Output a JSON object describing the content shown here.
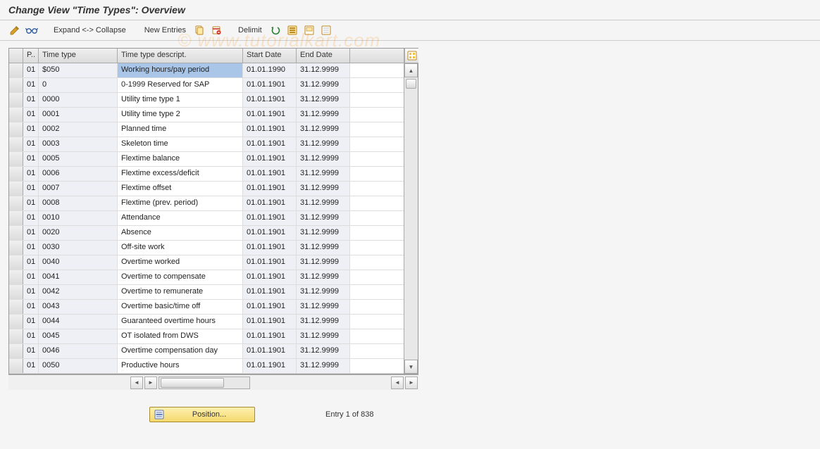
{
  "page": {
    "title": "Change View \"Time Types\": Overview"
  },
  "toolbar": {
    "expand_collapse": "Expand <-> Collapse",
    "new_entries": "New Entries",
    "delimit": "Delimit"
  },
  "table": {
    "columns": {
      "p": "P..",
      "time_type": "Time type",
      "descript": "Time type descript.",
      "start": "Start Date",
      "end": "End Date"
    },
    "rows": [
      {
        "p": "01",
        "tt": "$050",
        "d": "Working hours/pay period",
        "sd": "01.01.1990",
        "ed": "31.12.9999",
        "selected": true
      },
      {
        "p": "01",
        "tt": "0",
        "d": "0-1999 Reserved for SAP",
        "sd": "01.01.1901",
        "ed": "31.12.9999"
      },
      {
        "p": "01",
        "tt": "0000",
        "d": "Utility time type 1",
        "sd": "01.01.1901",
        "ed": "31.12.9999"
      },
      {
        "p": "01",
        "tt": "0001",
        "d": "Utility time type 2",
        "sd": "01.01.1901",
        "ed": "31.12.9999"
      },
      {
        "p": "01",
        "tt": "0002",
        "d": "Planned time",
        "sd": "01.01.1901",
        "ed": "31.12.9999"
      },
      {
        "p": "01",
        "tt": "0003",
        "d": "Skeleton time",
        "sd": "01.01.1901",
        "ed": "31.12.9999"
      },
      {
        "p": "01",
        "tt": "0005",
        "d": "Flextime balance",
        "sd": "01.01.1901",
        "ed": "31.12.9999"
      },
      {
        "p": "01",
        "tt": "0006",
        "d": "Flextime excess/deficit",
        "sd": "01.01.1901",
        "ed": "31.12.9999"
      },
      {
        "p": "01",
        "tt": "0007",
        "d": "Flextime offset",
        "sd": "01.01.1901",
        "ed": "31.12.9999"
      },
      {
        "p": "01",
        "tt": "0008",
        "d": "Flextime (prev. period)",
        "sd": "01.01.1901",
        "ed": "31.12.9999"
      },
      {
        "p": "01",
        "tt": "0010",
        "d": "Attendance",
        "sd": "01.01.1901",
        "ed": "31.12.9999"
      },
      {
        "p": "01",
        "tt": "0020",
        "d": "Absence",
        "sd": "01.01.1901",
        "ed": "31.12.9999"
      },
      {
        "p": "01",
        "tt": "0030",
        "d": "Off-site work",
        "sd": "01.01.1901",
        "ed": "31.12.9999"
      },
      {
        "p": "01",
        "tt": "0040",
        "d": "Overtime worked",
        "sd": "01.01.1901",
        "ed": "31.12.9999"
      },
      {
        "p": "01",
        "tt": "0041",
        "d": "Overtime to compensate",
        "sd": "01.01.1901",
        "ed": "31.12.9999"
      },
      {
        "p": "01",
        "tt": "0042",
        "d": "Overtime to remunerate",
        "sd": "01.01.1901",
        "ed": "31.12.9999"
      },
      {
        "p": "01",
        "tt": "0043",
        "d": "Overtime basic/time off",
        "sd": "01.01.1901",
        "ed": "31.12.9999"
      },
      {
        "p": "01",
        "tt": "0044",
        "d": "Guaranteed overtime hours",
        "sd": "01.01.1901",
        "ed": "31.12.9999"
      },
      {
        "p": "01",
        "tt": "0045",
        "d": "OT isolated from DWS",
        "sd": "01.01.1901",
        "ed": "31.12.9999"
      },
      {
        "p": "01",
        "tt": "0046",
        "d": "Overtime compensation day",
        "sd": "01.01.1901",
        "ed": "31.12.9999"
      },
      {
        "p": "01",
        "tt": "0050",
        "d": "Productive hours",
        "sd": "01.01.1901",
        "ed": "31.12.9999"
      }
    ]
  },
  "footer": {
    "position_label": "Position...",
    "entry_info": "Entry 1 of 838"
  },
  "watermark": "© www.tutorialkart.com"
}
